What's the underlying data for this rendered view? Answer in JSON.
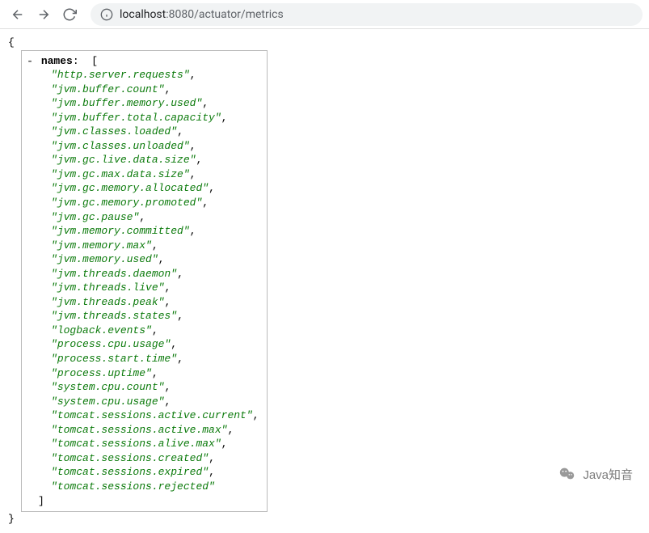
{
  "browser": {
    "url_host": "localhost",
    "url_port_path": ":8080/actuator/metrics"
  },
  "json": {
    "open_brace": "{",
    "close_brace": "}",
    "toggle": "-",
    "key": "names",
    "colon": ":",
    "open_bracket": "[",
    "close_bracket": "]",
    "names": [
      "http.server.requests",
      "jvm.buffer.count",
      "jvm.buffer.memory.used",
      "jvm.buffer.total.capacity",
      "jvm.classes.loaded",
      "jvm.classes.unloaded",
      "jvm.gc.live.data.size",
      "jvm.gc.max.data.size",
      "jvm.gc.memory.allocated",
      "jvm.gc.memory.promoted",
      "jvm.gc.pause",
      "jvm.memory.committed",
      "jvm.memory.max",
      "jvm.memory.used",
      "jvm.threads.daemon",
      "jvm.threads.live",
      "jvm.threads.peak",
      "jvm.threads.states",
      "logback.events",
      "process.cpu.usage",
      "process.start.time",
      "process.uptime",
      "system.cpu.count",
      "system.cpu.usage",
      "tomcat.sessions.active.current",
      "tomcat.sessions.active.max",
      "tomcat.sessions.alive.max",
      "tomcat.sessions.created",
      "tomcat.sessions.expired",
      "tomcat.sessions.rejected"
    ]
  },
  "watermark": {
    "text": "Java知音"
  }
}
